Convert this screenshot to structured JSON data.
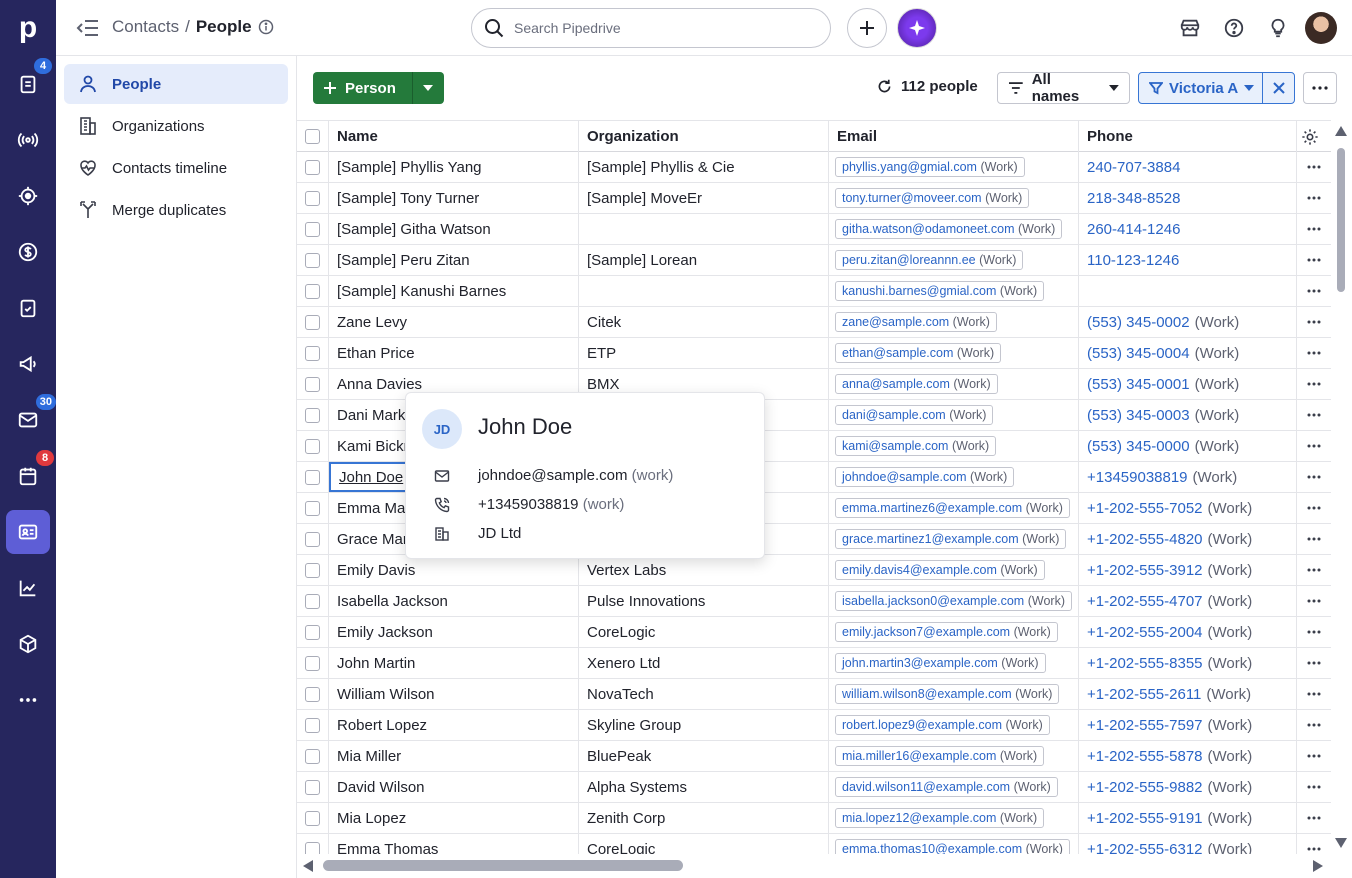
{
  "rail": {
    "logo": "p",
    "badges": {
      "activities": "4",
      "mail": "30",
      "calendar": "8"
    }
  },
  "topbar": {
    "breadcrumb_parent": "Contacts",
    "breadcrumb_sep": "/",
    "breadcrumb_current": "People",
    "search_placeholder": "Search Pipedrive"
  },
  "sidebar": {
    "items": [
      {
        "label": "People"
      },
      {
        "label": "Organizations"
      },
      {
        "label": "Contacts timeline"
      },
      {
        "label": "Merge duplicates"
      }
    ]
  },
  "toolbar": {
    "add_label": "Person",
    "count_label": "112 people",
    "filter_names": "All names",
    "filter_user": "Victoria A"
  },
  "table": {
    "columns": {
      "name": "Name",
      "org": "Organization",
      "email": "Email",
      "phone": "Phone"
    },
    "email_tag": "(Work)",
    "phone_tag": "(Work)",
    "rows": [
      {
        "name": "[Sample] Phyllis Yang",
        "org": "[Sample] Phyllis & Cie",
        "email": "phyllis.yang@gmial.com",
        "phone": "240-707-3884",
        "phone_tag": ""
      },
      {
        "name": "[Sample] Tony Turner",
        "org": "[Sample] MoveEr",
        "email": "tony.turner@moveer.com",
        "phone": "218-348-8528",
        "phone_tag": ""
      },
      {
        "name": "[Sample] Githa Watson",
        "org": "",
        "email": "githa.watson@odamoneet.com",
        "phone": "260-414-1246",
        "phone_tag": ""
      },
      {
        "name": "[Sample] Peru Zitan",
        "org": "[Sample] Lorean",
        "email": "peru.zitan@loreannn.ee",
        "phone": "110-123-1246",
        "phone_tag": ""
      },
      {
        "name": "[Sample] Kanushi Barnes",
        "org": "",
        "email": "kanushi.barnes@gmial.com",
        "phone": "",
        "phone_tag": ""
      },
      {
        "name": "Zane Levy",
        "org": "Citek",
        "email": "zane@sample.com",
        "phone": "(553) 345-0002",
        "phone_tag": "(Work)"
      },
      {
        "name": "Ethan Price",
        "org": "ETP",
        "email": "ethan@sample.com",
        "phone": "(553) 345-0004",
        "phone_tag": "(Work)"
      },
      {
        "name": "Anna Davies",
        "org": "BMX",
        "email": "anna@sample.com",
        "phone": "(553) 345-0001",
        "phone_tag": "(Work)"
      },
      {
        "name": "Dani Mark",
        "org": "",
        "email": "dani@sample.com",
        "phone": "(553) 345-0003",
        "phone_tag": "(Work)"
      },
      {
        "name": "Kami Bickn",
        "org": "",
        "email": "kami@sample.com",
        "phone": "(553) 345-0000",
        "phone_tag": "(Work)"
      },
      {
        "name": "John Doe",
        "org": "",
        "email": "johndoe@sample.com",
        "phone": "+13459038819",
        "phone_tag": "(Work)"
      },
      {
        "name": "Emma Mar",
        "org": "",
        "email": "emma.martinez6@example.com",
        "phone": "+1-202-555-7052",
        "phone_tag": "(Work)"
      },
      {
        "name": "Grace Mar",
        "org": "",
        "email": "grace.martinez1@example.com",
        "phone": "+1-202-555-4820",
        "phone_tag": "(Work)"
      },
      {
        "name": "Emily Davis",
        "org": "Vertex Labs",
        "email": "emily.davis4@example.com",
        "phone": "+1-202-555-3912",
        "phone_tag": "(Work)"
      },
      {
        "name": "Isabella Jackson",
        "org": "Pulse Innovations",
        "email": "isabella.jackson0@example.com",
        "phone": "+1-202-555-4707",
        "phone_tag": "(Work)"
      },
      {
        "name": "Emily Jackson",
        "org": "CoreLogic",
        "email": "emily.jackson7@example.com",
        "phone": "+1-202-555-2004",
        "phone_tag": "(Work)"
      },
      {
        "name": "John Martin",
        "org": "Xenero Ltd",
        "email": "john.martin3@example.com",
        "phone": "+1-202-555-8355",
        "phone_tag": "(Work)"
      },
      {
        "name": "William Wilson",
        "org": "NovaTech",
        "email": "william.wilson8@example.com",
        "phone": "+1-202-555-2611",
        "phone_tag": "(Work)"
      },
      {
        "name": "Robert Lopez",
        "org": "Skyline Group",
        "email": "robert.lopez9@example.com",
        "phone": "+1-202-555-7597",
        "phone_tag": "(Work)"
      },
      {
        "name": "Mia Miller",
        "org": "BluePeak",
        "email": "mia.miller16@example.com",
        "phone": "+1-202-555-5878",
        "phone_tag": "(Work)"
      },
      {
        "name": "David Wilson",
        "org": "Alpha Systems",
        "email": "david.wilson11@example.com",
        "phone": "+1-202-555-9882",
        "phone_tag": "(Work)"
      },
      {
        "name": "Mia Lopez",
        "org": "Zenith Corp",
        "email": "mia.lopez12@example.com",
        "phone": "+1-202-555-9191",
        "phone_tag": "(Work)"
      },
      {
        "name": "Emma Thomas",
        "org": "CoreLogic",
        "email": "emma.thomas10@example.com",
        "phone": "+1-202-555-6312",
        "phone_tag": "(Work)"
      }
    ]
  },
  "hover_card": {
    "initials": "JD",
    "name": "John Doe",
    "email": "johndoe@sample.com",
    "email_tag": "(work)",
    "phone": "+13459038819",
    "phone_tag": "(work)",
    "org": "JD Ltd"
  },
  "colors": {
    "rail_bg": "#26265e",
    "accent_green": "#247a3b",
    "link_blue": "#2a64c6",
    "active_rail": "#5e5ed6"
  }
}
